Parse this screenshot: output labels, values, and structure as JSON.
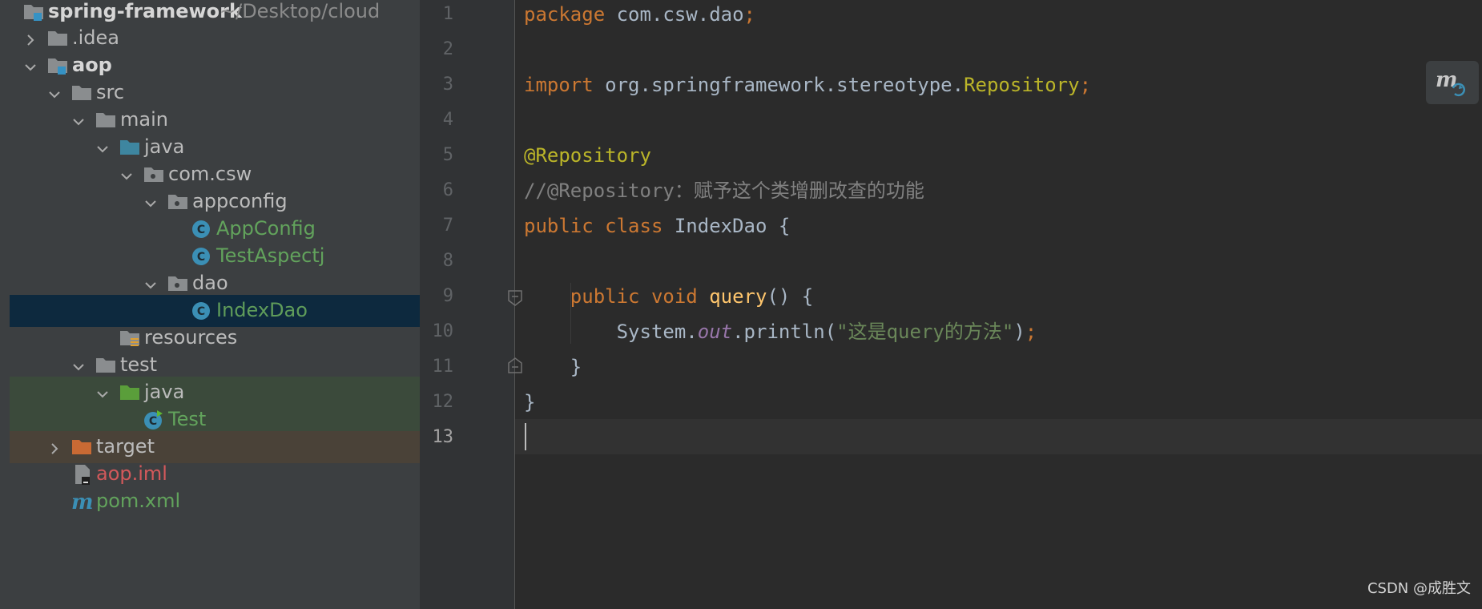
{
  "project_tree": {
    "root": {
      "name": "spring-framework",
      "path": "~/Desktop/cloud"
    },
    "items": [
      {
        "label": ".idea"
      },
      {
        "label": "aop"
      },
      {
        "label": "src"
      },
      {
        "label": "main"
      },
      {
        "label": "java"
      },
      {
        "label": "com.csw"
      },
      {
        "label": "appconfig"
      },
      {
        "label": "AppConfig"
      },
      {
        "label": "TestAspectj"
      },
      {
        "label": "dao"
      },
      {
        "label": "IndexDao"
      },
      {
        "label": "resources"
      },
      {
        "label": "test"
      },
      {
        "label": "java"
      },
      {
        "label": "Test"
      },
      {
        "label": "target"
      },
      {
        "label": "aop.iml"
      },
      {
        "label": "pom.xml"
      }
    ]
  },
  "editor": {
    "line_numbers": [
      "1",
      "2",
      "3",
      "4",
      "5",
      "6",
      "7",
      "8",
      "9",
      "10",
      "11",
      "12",
      "13"
    ],
    "current_line": 13,
    "code": {
      "l1": {
        "kw": "package",
        "rest": " com.csw.dao",
        "semi": ";"
      },
      "l3": {
        "kw": "import",
        "rest": " org.springframework.stereotype.",
        "cls": "Repository",
        "semi": ";"
      },
      "l5": {
        "ann": "@Repository"
      },
      "l6": {
        "comment": "//@Repository：赋予这个类增删改查的功能"
      },
      "l7": {
        "kw": "public class",
        "rest": " IndexDao {"
      },
      "l9": {
        "kw": "public void",
        "fn": "query",
        "rest": "() {"
      },
      "l10": {
        "obj": "System.",
        "field": "out",
        "call": ".println(",
        "str": "\"这是query的方法\"",
        "end": ")",
        "semi": ";"
      },
      "l11": {
        "brace": "}"
      },
      "l12": {
        "brace": "}"
      }
    }
  },
  "maven_button_icon": "maven-reload-icon",
  "watermark": "CSDN @成胜文",
  "colors": {
    "panel_bg": "#3c3f41",
    "editor_bg": "#2b2b2b",
    "selection_bg": "#0d293e",
    "keyword": "#cc7832",
    "annotation": "#bbb529",
    "comment": "#808080",
    "string": "#6a8759",
    "function": "#ffc66d"
  }
}
